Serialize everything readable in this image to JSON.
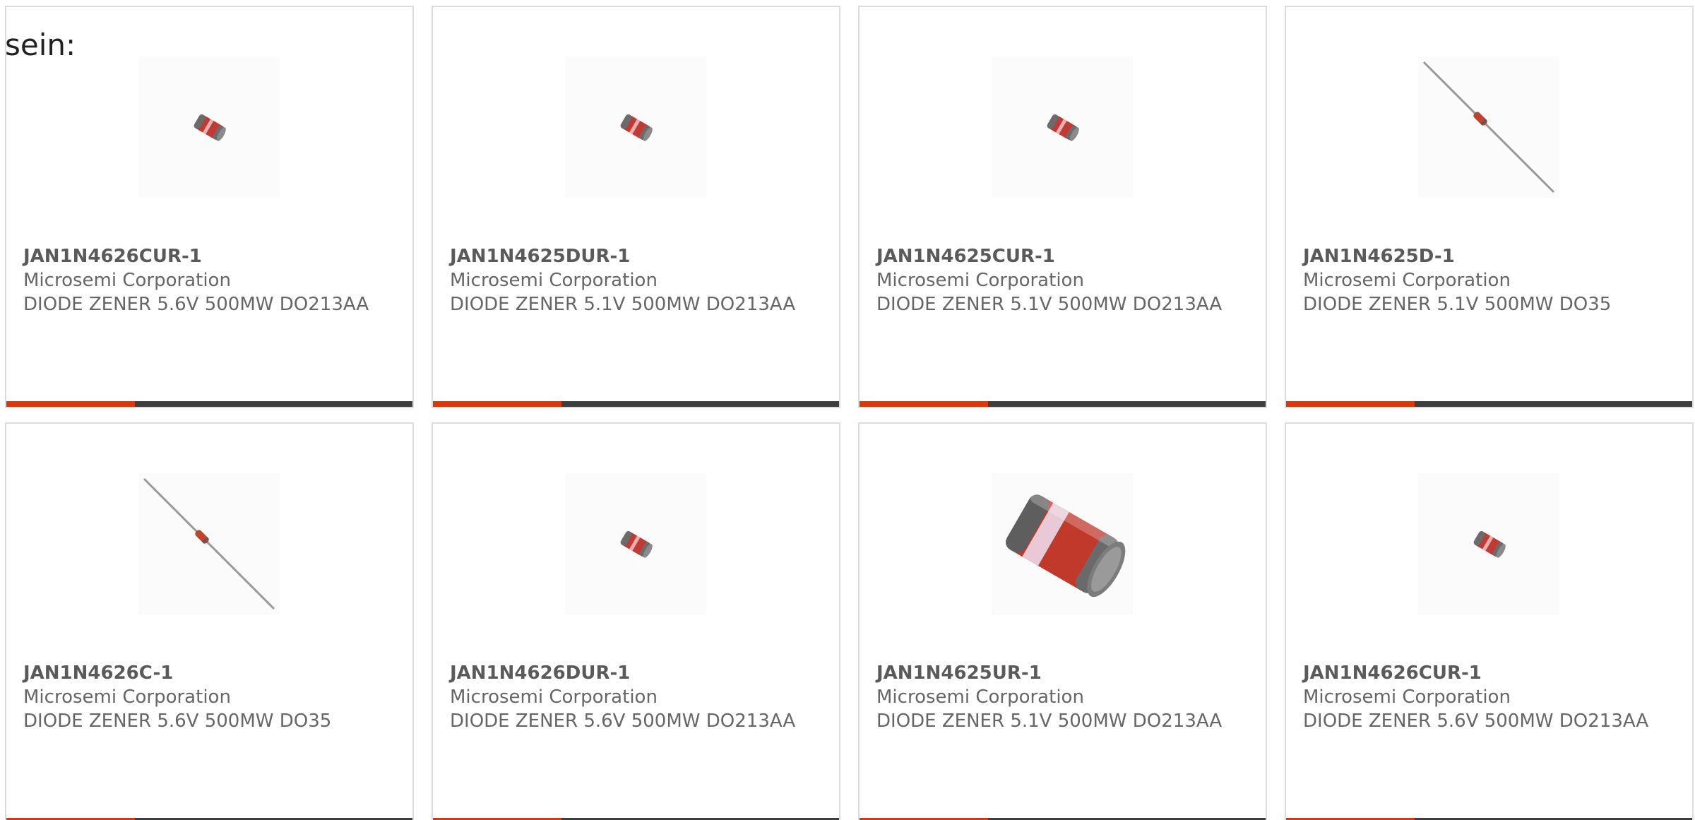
{
  "page": {
    "intro_text": "sein:",
    "accent_color": "#d9380f",
    "bar_color": "#3e3e3e"
  },
  "products": [
    {
      "part_number": "JAN1N4626CUR-1",
      "manufacturer": "Microsemi Corporation",
      "description": "DIODE ZENER 5.6V 500MW DO213AA",
      "image_icon": "melf-diode-small-icon"
    },
    {
      "part_number": "JAN1N4625DUR-1",
      "manufacturer": "Microsemi Corporation",
      "description": "DIODE ZENER 5.1V 500MW DO213AA",
      "image_icon": "melf-diode-small-icon"
    },
    {
      "part_number": "JAN1N4625CUR-1",
      "manufacturer": "Microsemi Corporation",
      "description": "DIODE ZENER 5.1V 500MW DO213AA",
      "image_icon": "melf-diode-small-icon"
    },
    {
      "part_number": "JAN1N4625D-1",
      "manufacturer": "Microsemi Corporation",
      "description": "DIODE ZENER 5.1V 500MW DO35",
      "image_icon": "axial-diode-icon"
    },
    {
      "part_number": "JAN1N4626C-1",
      "manufacturer": "Microsemi Corporation",
      "description": "DIODE ZENER 5.6V 500MW DO35",
      "image_icon": "axial-diode-icon"
    },
    {
      "part_number": "JAN1N4626DUR-1",
      "manufacturer": "Microsemi Corporation",
      "description": "DIODE ZENER 5.6V 500MW DO213AA",
      "image_icon": "melf-diode-small-icon"
    },
    {
      "part_number": "JAN1N4625UR-1",
      "manufacturer": "Microsemi Corporation",
      "description": "DIODE ZENER 5.1V 500MW DO213AA",
      "image_icon": "melf-diode-large-icon"
    },
    {
      "part_number": "JAN1N4626CUR-1",
      "manufacturer": "Microsemi Corporation",
      "description": "DIODE ZENER 5.6V 500MW DO213AA",
      "image_icon": "melf-diode-small-icon"
    }
  ]
}
